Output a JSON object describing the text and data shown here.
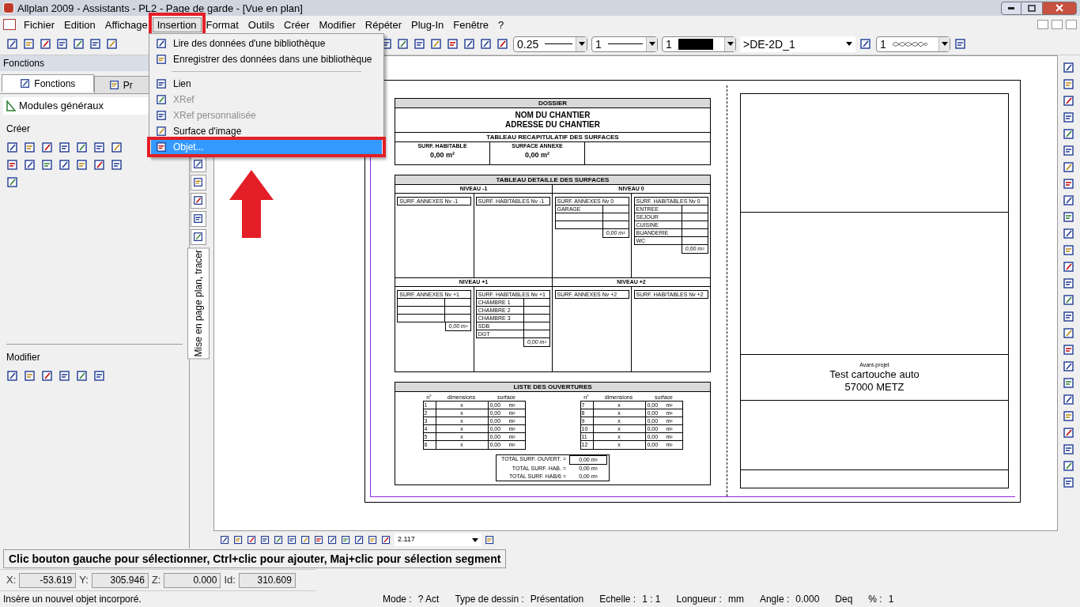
{
  "window": {
    "title": "Allplan 2009 - Assistants - PL2 - Page de garde - [Vue en plan]"
  },
  "menu": [
    {
      "label": "Fichier",
      "selected": false,
      "annotated": false
    },
    {
      "label": "Edition",
      "selected": false,
      "annotated": false
    },
    {
      "label": "Affichage",
      "selected": false,
      "annotated": false
    },
    {
      "label": "Insertion",
      "selected": true,
      "annotated": true
    },
    {
      "label": "Format",
      "selected": false,
      "annotated": false
    },
    {
      "label": "Outils",
      "selected": false,
      "annotated": false
    },
    {
      "label": "Créer",
      "selected": false,
      "annotated": false
    },
    {
      "label": "Modifier",
      "selected": false,
      "annotated": false
    },
    {
      "label": "Répéter",
      "selected": false,
      "annotated": false
    },
    {
      "label": "Plug-In",
      "selected": false,
      "annotated": false
    },
    {
      "label": "Fenêtre",
      "selected": false,
      "annotated": false
    },
    {
      "label": "?",
      "selected": false,
      "annotated": false
    }
  ],
  "insertion_menu": [
    {
      "kind": "item",
      "label": "Lire des données d'une bibliothèque",
      "disabled": false,
      "selected": false,
      "annotated": false
    },
    {
      "kind": "item",
      "label": "Enregistrer des données dans une bibliothèque",
      "disabled": false,
      "selected": false,
      "annotated": false
    },
    {
      "kind": "separator"
    },
    {
      "kind": "item",
      "label": "Lien",
      "disabled": false,
      "selected": false,
      "annotated": false
    },
    {
      "kind": "item",
      "label": "XRef",
      "disabled": true,
      "selected": false,
      "annotated": false
    },
    {
      "kind": "item",
      "label": "XRef personnalisée",
      "disabled": true,
      "selected": false,
      "annotated": false
    },
    {
      "kind": "item",
      "label": "Surface d'image",
      "disabled": false,
      "selected": false,
      "annotated": false
    },
    {
      "kind": "item",
      "label": "Objet...",
      "disabled": false,
      "selected": true,
      "annotated": true
    }
  ],
  "toolbar": {
    "pen": "0.25",
    "line": "1",
    "swatch": "1",
    "layer": ">DE-2D_1",
    "pattern": "1"
  },
  "left_panel": {
    "header": "Fonctions",
    "tabs": [
      {
        "label": "Fonctions",
        "selected": true
      },
      {
        "label": "Pr",
        "selected": false
      }
    ],
    "module": "Modules généraux",
    "sections": [
      {
        "title": "Créer"
      },
      {
        "title": "Modifier"
      }
    ],
    "vertical_tab": "Mise en page plan, tracer"
  },
  "sheet": {
    "header": "DOSSIER",
    "project_name": "NOM DU CHANTIER",
    "address": "ADRESSE DU CHANTIER",
    "summary_title": "TABLEAU RECAPITULATIF DES SURFACES",
    "summary": [
      {
        "label": "SURF. HABITABLE",
        "value": "0,00 m²"
      },
      {
        "label": "SURFACE ANNEXE",
        "value": "0,00 m²"
      }
    ],
    "detail_title": "TABLEAU DETAILLE DES SURFACES",
    "levels": [
      {
        "title": "NIVEAU -1",
        "tables": [
          {
            "title": "SURF. ANNEXES Nv -1"
          },
          {
            "title": "SURF. HABITABLES Nv -1"
          }
        ]
      },
      {
        "title": "NIVEAU 0",
        "tables": [
          {
            "title": "SURF. ANNEXES Nv 0",
            "rows": [
              {
                "kind": "labeled",
                "label": "GARAGE"
              },
              {
                "kind": "blank"
              },
              {
                "kind": "blank"
              }
            ],
            "total": "0,00 m²"
          },
          {
            "title": "SURF. HABITABLES Nv 0",
            "rows": [
              {
                "kind": "labeled",
                "label": "ENTREE"
              },
              {
                "kind": "labeled",
                "label": "SEJOUR"
              },
              {
                "kind": "labeled",
                "label": "CUISINE"
              },
              {
                "kind": "labeled",
                "label": "BUANDERIE"
              },
              {
                "kind": "labeled",
                "label": "WC"
              }
            ],
            "total": "0,00 m²"
          }
        ]
      },
      {
        "title": "NIVEAU +1",
        "tables": [
          {
            "title": "SURF. ANNEXES Nv +1",
            "rows": [
              {
                "kind": "blank"
              },
              {
                "kind": "blank"
              },
              {
                "kind": "blank"
              }
            ],
            "total": "0,00 m²"
          },
          {
            "title": "SURF. HABITABLES Nv +1",
            "rows": [
              {
                "kind": "labeled",
                "label": "CHAMBRE 1"
              },
              {
                "kind": "labeled",
                "label": "CHAMBRE 2"
              },
              {
                "kind": "labeled",
                "label": "CHAMBRE 3"
              },
              {
                "kind": "labeled",
                "label": "SDB"
              },
              {
                "kind": "labeled",
                "label": "DGT"
              }
            ],
            "total": "0,00 m²"
          }
        ]
      },
      {
        "title": "NIVEAU +2",
        "tables": [
          {
            "title": "SURF. ANNEXES Nv +2"
          },
          {
            "title": "SURF. HABITABLES Nv +2"
          }
        ]
      }
    ],
    "openings_title": "LISTE DES OUVERTURES",
    "openings": [
      {
        "columns": [
          "n°",
          "dimensions",
          "surface"
        ],
        "rows": [
          {
            "n": "1",
            "dim": "x",
            "surface": "0,00",
            "unit": "m²"
          },
          {
            "n": "2",
            "dim": "x",
            "surface": "0,00",
            "unit": "m²"
          },
          {
            "n": "3",
            "dim": "x",
            "surface": "0,00",
            "unit": "m²"
          },
          {
            "n": "4",
            "dim": "x",
            "surface": "0,00",
            "unit": "m²"
          },
          {
            "n": "5",
            "dim": "x",
            "surface": "0,00",
            "unit": "m²"
          },
          {
            "n": "6",
            "dim": "x",
            "surface": "0,00",
            "unit": "m²"
          }
        ]
      },
      {
        "columns": [
          "n°",
          "dimensions",
          "surface"
        ],
        "rows": [
          {
            "n": "7",
            "dim": "x",
            "surface": "0,00",
            "unit": "m²"
          },
          {
            "n": "8",
            "dim": "x",
            "surface": "0,00",
            "unit": "m²"
          },
          {
            "n": "9",
            "dim": "x",
            "surface": "0,00",
            "unit": "m²"
          },
          {
            "n": "10",
            "dim": "x",
            "surface": "0,00",
            "unit": "m²"
          },
          {
            "n": "11",
            "dim": "x",
            "surface": "0,00",
            "unit": "m²"
          },
          {
            "n": "12",
            "dim": "x",
            "surface": "0,00",
            "unit": "m²"
          }
        ]
      }
    ],
    "totals": [
      {
        "label": "TOTAL SURF. OUVERT. =",
        "value": "0,00 m²"
      },
      {
        "label": "TOTAL SURF. HAB. =",
        "value": "0,00 m²"
      },
      {
        "label": "TOTAL SURF. HAB/6 =",
        "value": "0,00 m²"
      }
    ],
    "cartouche": {
      "phase": "Avant-projet",
      "title": "Test cartouche auto",
      "city": "57000 METZ"
    }
  },
  "canvas_toolbar": {
    "zoom": "2.117"
  },
  "prompt": "Clic bouton gauche pour sélectionner, Ctrl+clic pour ajouter, Maj+clic pour sélection segment",
  "coordinates": [
    {
      "label": "X:",
      "value": "-53.619"
    },
    {
      "label": "Y:",
      "value": "305.946"
    },
    {
      "label": "Z:",
      "value": "0.000"
    },
    {
      "label": "Id:",
      "value": "310.609"
    }
  ],
  "status_bar": {
    "message": "Insère un nouvel objet incorporé.",
    "fields": [
      {
        "label": "Mode :",
        "value": "? Act"
      },
      {
        "label": "Type de dessin :",
        "value": "Présentation"
      },
      {
        "label": "Echelle :",
        "value": "1 : 1"
      },
      {
        "label": "Longueur :",
        "value": "mm"
      },
      {
        "label": "Angle :",
        "value": "0.000"
      },
      {
        "label": "Deq"
      },
      {
        "label": "% :",
        "value": "1"
      }
    ]
  }
}
